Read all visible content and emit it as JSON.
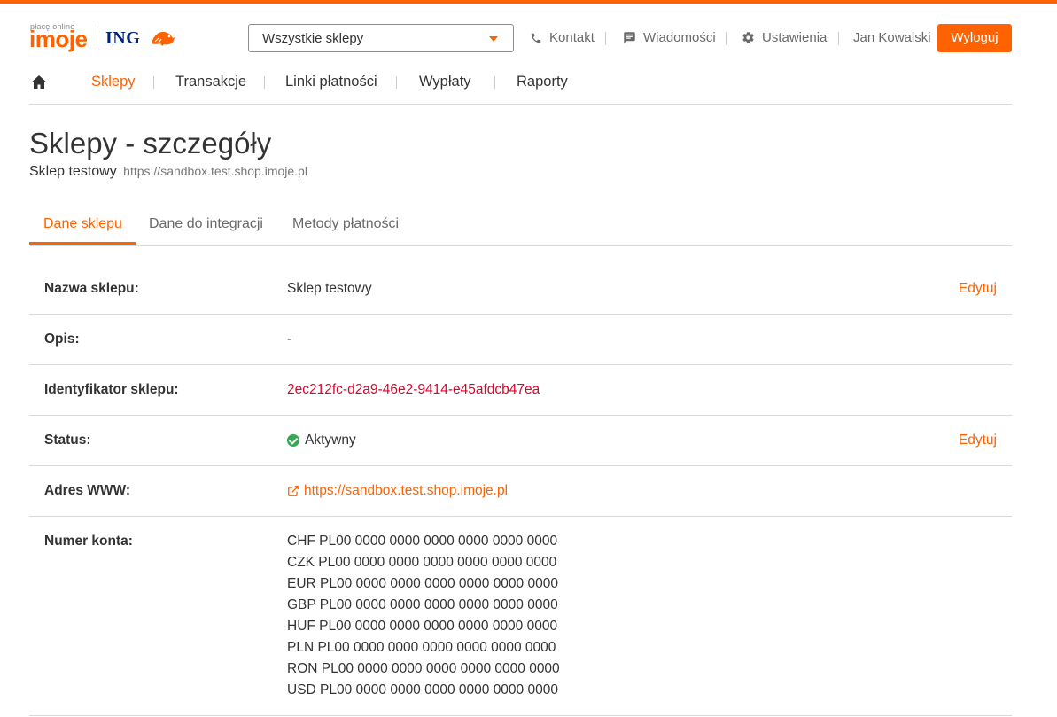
{
  "brand": {
    "logo_small": "płacę online",
    "logo_main": "imoje",
    "partner": "ING",
    "accent": "#ff6200"
  },
  "header": {
    "store_select_value": "Wszystkie sklepy",
    "contact": "Kontakt",
    "messages": "Wiadomości",
    "settings": "Ustawienia",
    "user": "Jan Kowalski",
    "logout": "Wyloguj"
  },
  "nav": {
    "home_icon": "home-icon",
    "items": [
      "Sklepy",
      "Transakcje",
      "Linki płatności",
      "Wypłaty",
      "Raporty"
    ],
    "active": "Sklepy"
  },
  "page": {
    "title": "Sklepy - szczegóły",
    "store_name": "Sklep testowy",
    "store_url": "https://sandbox.test.shop.imoje.pl"
  },
  "tabs": {
    "items": [
      "Dane sklepu",
      "Dane do integracji",
      "Metody płatności"
    ],
    "active": "Dane sklepu"
  },
  "details": {
    "name": {
      "label": "Nazwa sklepu:",
      "value": "Sklep testowy",
      "action": "Edytuj"
    },
    "description": {
      "label": "Opis:",
      "value": "-"
    },
    "id": {
      "label": "Identyfikator sklepu:",
      "value": "2ec212fc-d2a9-46e2-9414-e45afdcb47ea"
    },
    "status": {
      "label": "Status:",
      "value": "Aktywny",
      "action": "Edytuj",
      "color": "#34a853"
    },
    "www": {
      "label": "Adres WWW:",
      "value": "https://sandbox.test.shop.imoje.pl"
    },
    "account": {
      "label": "Numer konta:",
      "values": [
        "CHF PL00 0000 0000 0000 0000 0000 0000",
        "CZK PL00 0000 0000 0000 0000 0000 0000",
        "EUR PL00 0000 0000 0000 0000 0000 0000",
        "GBP PL00 0000 0000 0000 0000 0000 0000",
        "HUF PL00 0000 0000 0000 0000 0000 0000",
        "PLN PL00 0000 0000 0000 0000 0000 0000",
        "RON PL00 0000 0000 0000 0000 0000 0000",
        "USD PL00 0000 0000 0000 0000 0000 0000"
      ]
    }
  }
}
